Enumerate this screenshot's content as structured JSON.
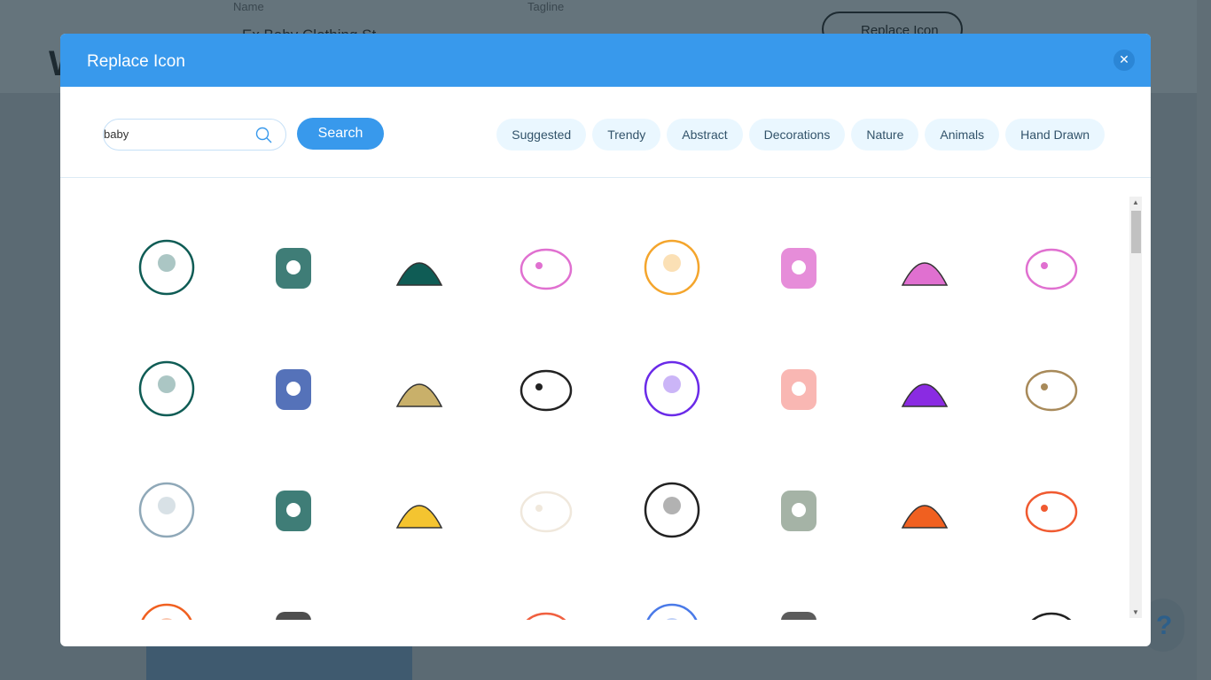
{
  "background": {
    "name_label": "Name",
    "tagline_label": "Tagline",
    "name_value": "Ex Baby Clothing St",
    "replace_icon_button": "Replace Icon",
    "help": "?"
  },
  "modal": {
    "title": "Replace Icon",
    "close_icon": "close-icon",
    "search": {
      "value": "baby",
      "placeholder": "",
      "button": "Search"
    },
    "categories": [
      "Suggested",
      "Trendy",
      "Abstract",
      "Decorations",
      "Nature",
      "Animals",
      "Hand Drawn"
    ],
    "icons": [
      {
        "name": "baby-mobile-icon",
        "color": "#0f5c55"
      },
      {
        "name": "baby-monitor-icon",
        "color": "#0f5c55"
      },
      {
        "name": "sleeping-baby-cloud-icon",
        "color": "#0f5c55"
      },
      {
        "name": "pink-mobile-icon",
        "color": "#e070d0"
      },
      {
        "name": "chick-icon",
        "color": "#f4a52c"
      },
      {
        "name": "stroller-icon",
        "color": "#e070d0"
      },
      {
        "name": "overalls-icon",
        "color": "#e070d0"
      },
      {
        "name": "baby-shoe-icon",
        "color": "#e070d0"
      },
      {
        "name": "swaddled-baby-icon",
        "color": "#0f5c55"
      },
      {
        "name": "pacifier-icon",
        "color": "#2a4fa8"
      },
      {
        "name": "duck-icon",
        "color": "#c9b06a"
      },
      {
        "name": "scribble-icon",
        "color": "#222222"
      },
      {
        "name": "parrot-icon",
        "color": "#6a2ae8"
      },
      {
        "name": "baby-clothes-icon",
        "color": "#f8a5a0"
      },
      {
        "name": "rabbit-icon",
        "color": "#8a2be2"
      },
      {
        "name": "girl-face-icon",
        "color": "#a88a5a"
      },
      {
        "name": "wreath-icon",
        "color": "#8fa8b8"
      },
      {
        "name": "moon-icon",
        "color": "#0f5c55"
      },
      {
        "name": "dots-icon",
        "color": "#f4c430"
      },
      {
        "name": "cat-icon",
        "color": "#f0e8dc"
      },
      {
        "name": "sleeping-child-icon",
        "color": "#222222"
      },
      {
        "name": "mother-baby-icon",
        "color": "#8fa090"
      },
      {
        "name": "bird-icon",
        "color": "#f06020"
      },
      {
        "name": "dog-face-icon",
        "color": "#f05a30"
      },
      {
        "name": "child-reading-icon",
        "color": "#f06020"
      },
      {
        "name": "eyes-icon",
        "color": "#222222"
      },
      {
        "name": "letter-block-icon",
        "color": "#f4e04a"
      },
      {
        "name": "kite-icon",
        "color": "#f06040"
      },
      {
        "name": "blue-creature-icon",
        "color": "#4a7ae8"
      },
      {
        "name": "flying-angel-icon",
        "color": "#333333"
      },
      {
        "name": "deer-icon",
        "color": "#a0684a"
      },
      {
        "name": "grass-icon",
        "color": "#222222"
      }
    ]
  }
}
